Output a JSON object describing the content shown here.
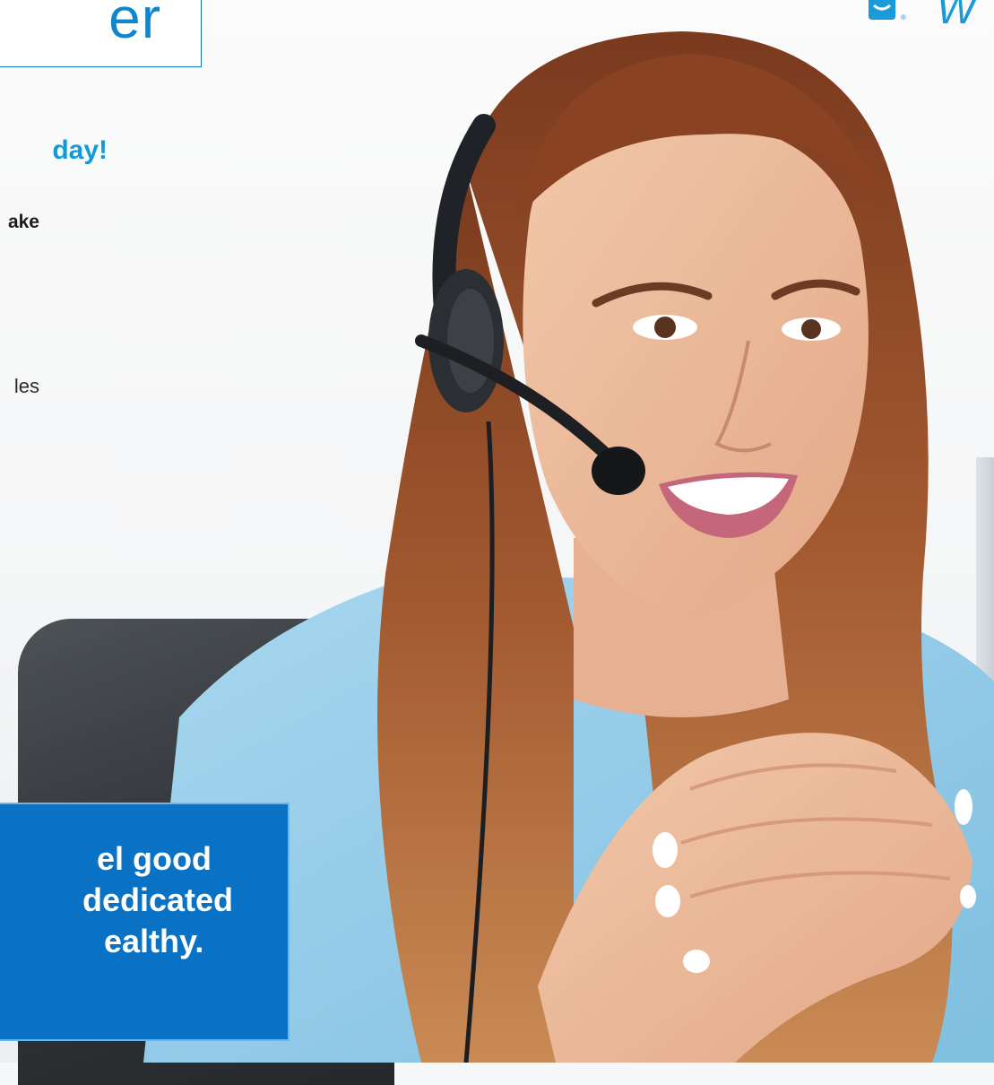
{
  "title": "er",
  "headline": "day!",
  "subline": "ake",
  "body_fragment": "les",
  "callout": {
    "line1": "el good",
    "line2": "dedicated",
    "line3": "ealthy."
  },
  "logo_letter": "W",
  "colors": {
    "brand_blue": "#0f86cf",
    "headline_blue": "#139ad7",
    "callout_bg": "#0a72c4",
    "shirt_blue": "#9ccfe9",
    "hair": "#9a4f2b"
  },
  "icons": [
    "headset-icon",
    "logo-mark-icon"
  ]
}
